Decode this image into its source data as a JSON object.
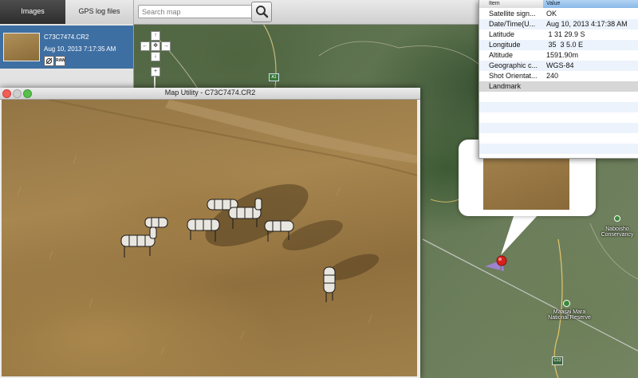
{
  "tabs": [
    {
      "label": "Images",
      "active": true
    },
    {
      "label": "GPS log files",
      "active": false
    }
  ],
  "search": {
    "placeholder": "Search map",
    "value": "",
    "icon": "search-icon"
  },
  "sidebar": {
    "image": {
      "name": "C73C7474.CR2",
      "date": "Aug 10, 2013 7:17:35 AM",
      "icons": [
        "gps-icon",
        "raw-icon"
      ],
      "raw_label": "RAW"
    }
  },
  "map_controls": {
    "up": "↑",
    "down": "↓",
    "left": "←",
    "right": "→",
    "center": "✥",
    "zoom_in": "+"
  },
  "map_window": {
    "title": "Map Utility - C73C7474.CR2"
  },
  "info_table": {
    "headers": {
      "item": "Item",
      "value": "Value"
    },
    "rows": [
      {
        "item": "Satellite sign...",
        "value": "OK"
      },
      {
        "item": "Date/Time(U...",
        "value": "Aug 10, 2013 4:17:38 AM"
      },
      {
        "item": "Latitude",
        "value": " 1 31 29.9 S"
      },
      {
        "item": "Longitude",
        "value": " 35  3 5.0 E"
      },
      {
        "item": "Altitude",
        "value": "1591.90m"
      },
      {
        "item": "Geographic c...",
        "value": "WGS-84"
      },
      {
        "item": "Shot Orientat...",
        "value": "240"
      },
      {
        "item": "Landmark",
        "value": ""
      }
    ]
  },
  "map_labels": {
    "road_sign": "A1",
    "naboisho": "Naboisho\nConservancy",
    "masai_mara": "Maasai Mara\nNational Reserve",
    "c13": "C13"
  },
  "colors": {
    "active_tab": "#2d2d2d",
    "selection_blue": "#3e6fa3",
    "pin_red": "#d8201c",
    "header_blue": "#8ab8e8"
  }
}
